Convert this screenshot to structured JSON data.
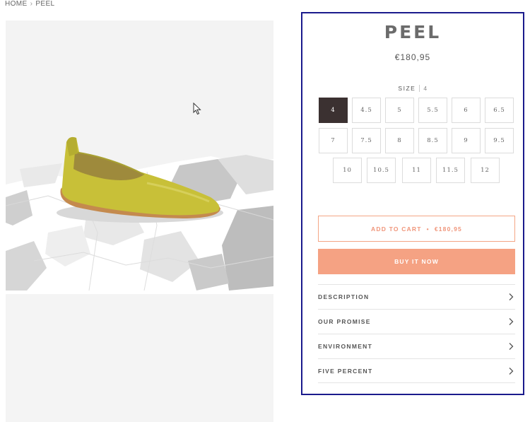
{
  "breadcrumb": {
    "home": "HOME",
    "separator": "›",
    "current": "PEEL"
  },
  "product": {
    "title": "PEEL",
    "price": "€180,95"
  },
  "size": {
    "label": "SIZE",
    "selected_value": "4",
    "options": [
      "4",
      "4.5",
      "5",
      "5.5",
      "6",
      "6.5",
      "7",
      "7.5",
      "8",
      "8.5",
      "9",
      "9.5",
      "10",
      "10.5",
      "11",
      "11.5",
      "12"
    ]
  },
  "actions": {
    "add_to_cart": "ADD TO CART",
    "add_to_cart_separator": "•",
    "add_to_cart_price": "€180,95",
    "buy_now": "BUY IT NOW"
  },
  "accordion": [
    {
      "label": "DESCRIPTION"
    },
    {
      "label": "OUR PROMISE"
    },
    {
      "label": "ENVIRONMENT"
    },
    {
      "label": "FIVE PERCENT"
    }
  ],
  "colors": {
    "panel_border": "#1a1a8c",
    "selected_size": "#3b3131",
    "accent": "#f5a283",
    "shoe": "#c9c236"
  },
  "icons": {
    "cursor": "mouse-pointer-icon",
    "chevron": "chevron-right-icon"
  }
}
